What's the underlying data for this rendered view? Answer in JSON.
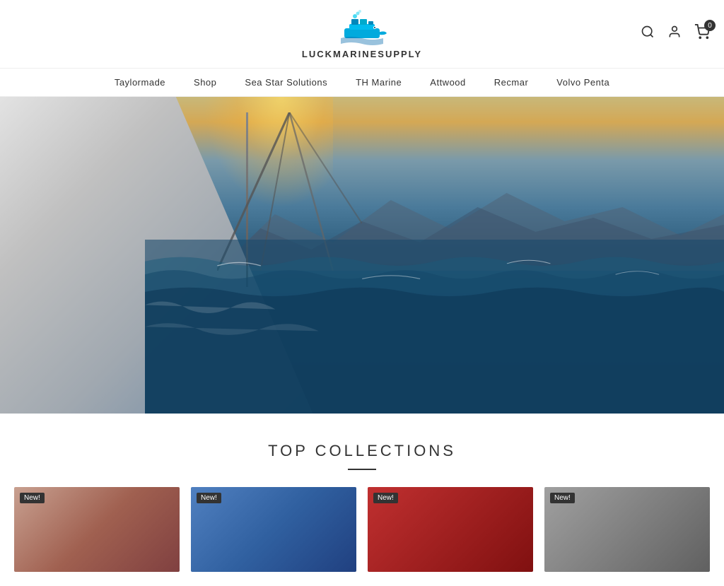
{
  "header": {
    "logo_text": "LUCKMARINESUPPLY",
    "cart_count": "0"
  },
  "nav": {
    "items": [
      {
        "label": "Taylormade",
        "id": "taylormade"
      },
      {
        "label": "Shop",
        "id": "shop"
      },
      {
        "label": "Sea Star Solutions",
        "id": "sea-star-solutions"
      },
      {
        "label": "TH Marine",
        "id": "th-marine"
      },
      {
        "label": "Attwood",
        "id": "attwood"
      },
      {
        "label": "Recmar",
        "id": "recmar"
      },
      {
        "label": "Volvo Penta",
        "id": "volvo-penta"
      }
    ]
  },
  "collections": {
    "title": "TOP COLLECTIONS",
    "products": [
      {
        "badge": "New!",
        "id": "product-1"
      },
      {
        "badge": "New!",
        "id": "product-2"
      },
      {
        "badge": "New!",
        "id": "product-3"
      },
      {
        "badge": "New!",
        "id": "product-4"
      }
    ]
  },
  "icons": {
    "search": "🔍",
    "user": "👤",
    "cart": "🛒"
  }
}
